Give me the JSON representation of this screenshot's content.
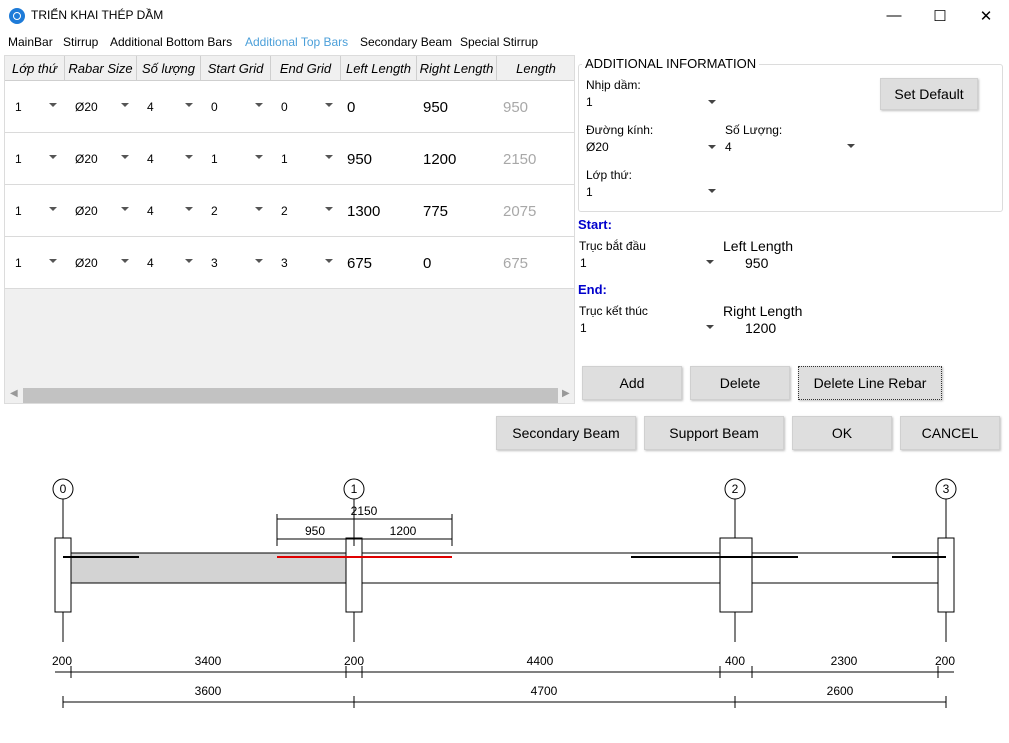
{
  "window": {
    "title": "TRIỂN KHAI THÉP DẦM",
    "minimize": "—",
    "maximize": "☐",
    "close": "✕"
  },
  "menu": [
    "MainBar",
    "Stirrup",
    "Additional Bottom Bars",
    "Additional Top Bars",
    "Secondary Beam",
    "Special Stirrup"
  ],
  "grid": {
    "headers": [
      "Lớp thứ",
      "Rabar Size",
      "Số lượng",
      "Start Grid",
      "End Grid",
      "Left Length",
      "Right Length",
      "Length"
    ],
    "rows": [
      [
        "1",
        "Ø20",
        "4",
        "0",
        "0",
        "0",
        "950",
        "950"
      ],
      [
        "1",
        "Ø20",
        "4",
        "1",
        "1",
        "950",
        "1200",
        "2150"
      ],
      [
        "1",
        "Ø20",
        "4",
        "2",
        "2",
        "1300",
        "775",
        "2075"
      ],
      [
        "1",
        "Ø20",
        "4",
        "3",
        "3",
        "675",
        "0",
        "675"
      ]
    ]
  },
  "info": {
    "legend": "ADDITIONAL INFORMATION",
    "nhip_label": "Nhịp dầm:",
    "nhip_value": "1",
    "duongkinh_label": "Đường kính:",
    "duongkinh_value": "Ø20",
    "soluong_label": "Số Lượng:",
    "soluong_value": "4",
    "lop_label": "Lớp thứ:",
    "lop_value": "1",
    "set_default": "Set Default"
  },
  "start": {
    "section": "Start:",
    "truc_label": "Trục bắt đầu",
    "truc_value": "1",
    "len_label": "Left Length",
    "len_value": "950"
  },
  "end": {
    "section": "End:",
    "truc_label": "Trục kết thúc",
    "truc_value": "1",
    "len_label": "Right Length",
    "len_value": "1200"
  },
  "buttons": {
    "add": "Add",
    "delete": "Delete",
    "delete_line": "Delete Line Rebar",
    "secondary": "Secondary Beam",
    "support": "Support Beam",
    "ok": "OK",
    "cancel": "CANCEL"
  },
  "drawing": {
    "grid_labels": [
      "0",
      "1",
      "2",
      "3"
    ],
    "top_dims": {
      "total": "2150",
      "left": "950",
      "right": "1200"
    },
    "dims_row1": [
      "200",
      "3400",
      "200",
      "4400",
      "400",
      "2300",
      "200"
    ],
    "dims_row2": [
      "3600",
      "4700",
      "2600"
    ],
    "colors": {
      "active_rebar": "#e00000",
      "rebar": "#000000",
      "beam_fill": "#d3d3d3"
    }
  }
}
